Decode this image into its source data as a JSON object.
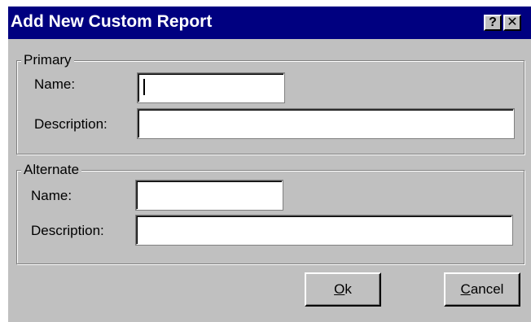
{
  "window": {
    "title": "Add New Custom Report",
    "help_glyph": "?",
    "close_glyph": "✕"
  },
  "primary": {
    "legend": "Primary",
    "name_label": "Name:",
    "description_label": "Description:",
    "name_value": "",
    "description_value": ""
  },
  "alternate": {
    "legend": "Alternate",
    "name_label": "Name:",
    "description_label": "Description:",
    "name_value": "",
    "description_value": ""
  },
  "buttons": {
    "ok_mnemonic": "O",
    "ok_rest": "k",
    "cancel_mnemonic": "C",
    "cancel_rest": "ancel"
  },
  "colors": {
    "titlebar": "#000080",
    "dialog_face": "#c0c0c0"
  },
  "icons": {
    "help": "help-icon",
    "close": "close-icon"
  }
}
